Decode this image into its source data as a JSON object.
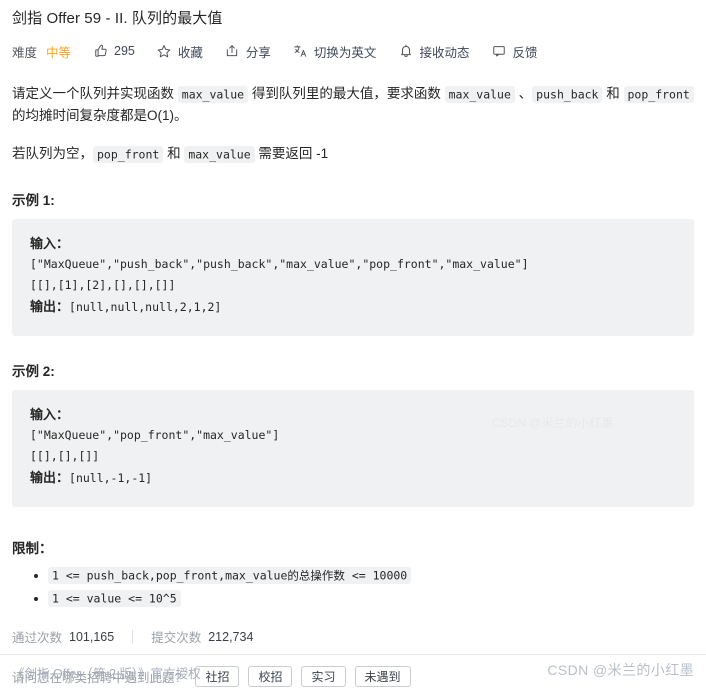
{
  "problem": {
    "title": "剑指 Offer 59 - II. 队列的最大值"
  },
  "toolbar": {
    "difficulty_label": "难度",
    "difficulty_value": "中等",
    "difficulty_color": "#ffa116",
    "like_count": "295",
    "favorite_label": "收藏",
    "share_label": "分享",
    "translate_label": "切换为英文",
    "subscribe_label": "接收动态",
    "feedback_label": "反馈",
    "icons": {
      "like": "thumbs-up-icon",
      "favorite": "star-icon",
      "share": "share-icon",
      "translate": "translate-icon",
      "subscribe": "bell-icon",
      "feedback": "comment-icon"
    }
  },
  "description": {
    "p1_part1": "请定义一个队列并实现函数 ",
    "p1_code1": "max_value",
    "p1_part2": " 得到队列里的最大值，要求函数 ",
    "p1_code2": "max_value",
    "p1_part3": " 、",
    "p1_code3": "push_back",
    "p1_part4": " 和 ",
    "p1_code4": "pop_front",
    "p1_part5": " 的均摊时间复杂度都是O(1)。",
    "p2_part1": "若队列为空，",
    "p2_code1": "pop_front",
    "p2_part2": " 和 ",
    "p2_code2": "max_value",
    "p2_part3": " 需要返回 -1"
  },
  "examples": [
    {
      "heading": "示例 1:",
      "input_label": "输入：",
      "input_line1": "[\"MaxQueue\",\"push_back\",\"push_back\",\"max_value\",\"pop_front\",\"max_value\"]",
      "input_line2": "[[],[1],[2],[],[],[]]",
      "output_label": "输出：",
      "output_value": "[null,null,null,2,1,2]"
    },
    {
      "heading": "示例 2:",
      "input_label": "输入：",
      "input_line1": "[\"MaxQueue\",\"pop_front\",\"max_value\"]",
      "input_line2": "[[],[],[]]",
      "output_label": "输出：",
      "output_value": "[null,-1,-1]"
    }
  ],
  "constraints": {
    "heading": "限制：",
    "items": [
      "1 <= push_back,pop_front,max_value的总操作数  <= 10000",
      "1 <= value <= 10^5"
    ]
  },
  "stats": {
    "passed_label": "通过次数",
    "passed_value": "101,165",
    "submitted_label": "提交次数",
    "submitted_value": "212,734"
  },
  "survey": {
    "question": "请问您在哪类招聘中遇到此题?",
    "options": [
      "社招",
      "校招",
      "实习",
      "未遇到"
    ]
  },
  "footer": {
    "text": "《剑指 Offer（第 2 版）》官方授权"
  },
  "watermark": {
    "main": "CSDN @米兰的小红墨",
    "faint": "CSDN @米兰的小红墨"
  }
}
